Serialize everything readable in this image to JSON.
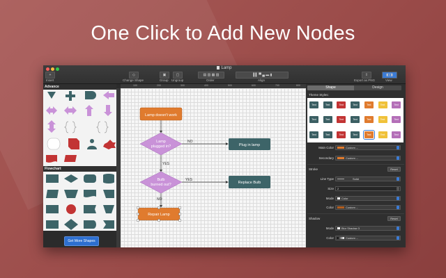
{
  "headline": "One Click to Add New Nodes",
  "window": {
    "title": "Lamp",
    "traffic_colors": [
      "#fc615d",
      "#fdbc40",
      "#34c84a"
    ]
  },
  "toolbar": {
    "insert_label": "Insert",
    "change_shape_label": "Change Shape",
    "group_label": "Group",
    "ungroup_label": "Ungroup",
    "order_label": "Order",
    "align_label": "Align",
    "export_label": "Export as PNG",
    "view_label": "View"
  },
  "ruler_ticks": [
    "100",
    "200",
    "300",
    "400",
    "500",
    "600",
    "700",
    "800"
  ],
  "shape_panel": {
    "advance_header": "Advance",
    "flowchart_header": "Flowchart",
    "get_more_label": "Get More Shapes"
  },
  "flowchart": {
    "start": "Lamp doesn't work",
    "decision1_line1": "Lamp",
    "decision1_line2": "plugged in?",
    "no1": "NO",
    "action1": "Plug in lamp",
    "yes1": "YES",
    "decision2_line1": "Bulb",
    "decision2_line2": "burned out?",
    "yes2": "YES",
    "action2": "Replace Bulb",
    "no2": "NO",
    "end": "Repair Lamp"
  },
  "colors": {
    "orange": "#e07b2e",
    "violet": "#c992d8",
    "teal": "#3d6468",
    "accent": "#2d6fd0"
  },
  "inspector": {
    "tab_shape": "Shape",
    "tab_design": "Design",
    "theme_styles_label": "Theme Styles:",
    "theme_cell_text": "Text",
    "theme_colors": [
      "#3b5f63",
      "#3b5f63",
      "#c23434",
      "#3b5f63",
      "#e07b2e",
      "#f0c23a",
      "#b46fb8",
      "#3b5f63",
      "#3b5f63",
      "#c23434",
      "#3b5f63",
      "#e07b2e",
      "#f0c23a",
      "#b46fb8",
      "#3b5f63",
      "#3b5f63",
      "#c23434",
      "#3b5f63",
      "#e07b2e",
      "#f0c23a",
      "#b46fb8"
    ],
    "main_color_label": "Main Color",
    "main_color_value": "Custom ...",
    "secondary_label": "Secondary",
    "secondary_value": "Custom ...",
    "stroke_header": "Stroke",
    "line_type_label": "Line Type",
    "line_type_value": "Solid",
    "size_label": "Size",
    "size_value": "2",
    "mode_label": "Mode",
    "stroke_mode_value": "Color",
    "color_label": "Color",
    "stroke_color_value": "Custom ...",
    "shadow_header": "Shadow",
    "shadow_mode_value": "Blur Shadow 3",
    "shadow_color_value": "Custom ...",
    "reset_label": "Reset"
  }
}
